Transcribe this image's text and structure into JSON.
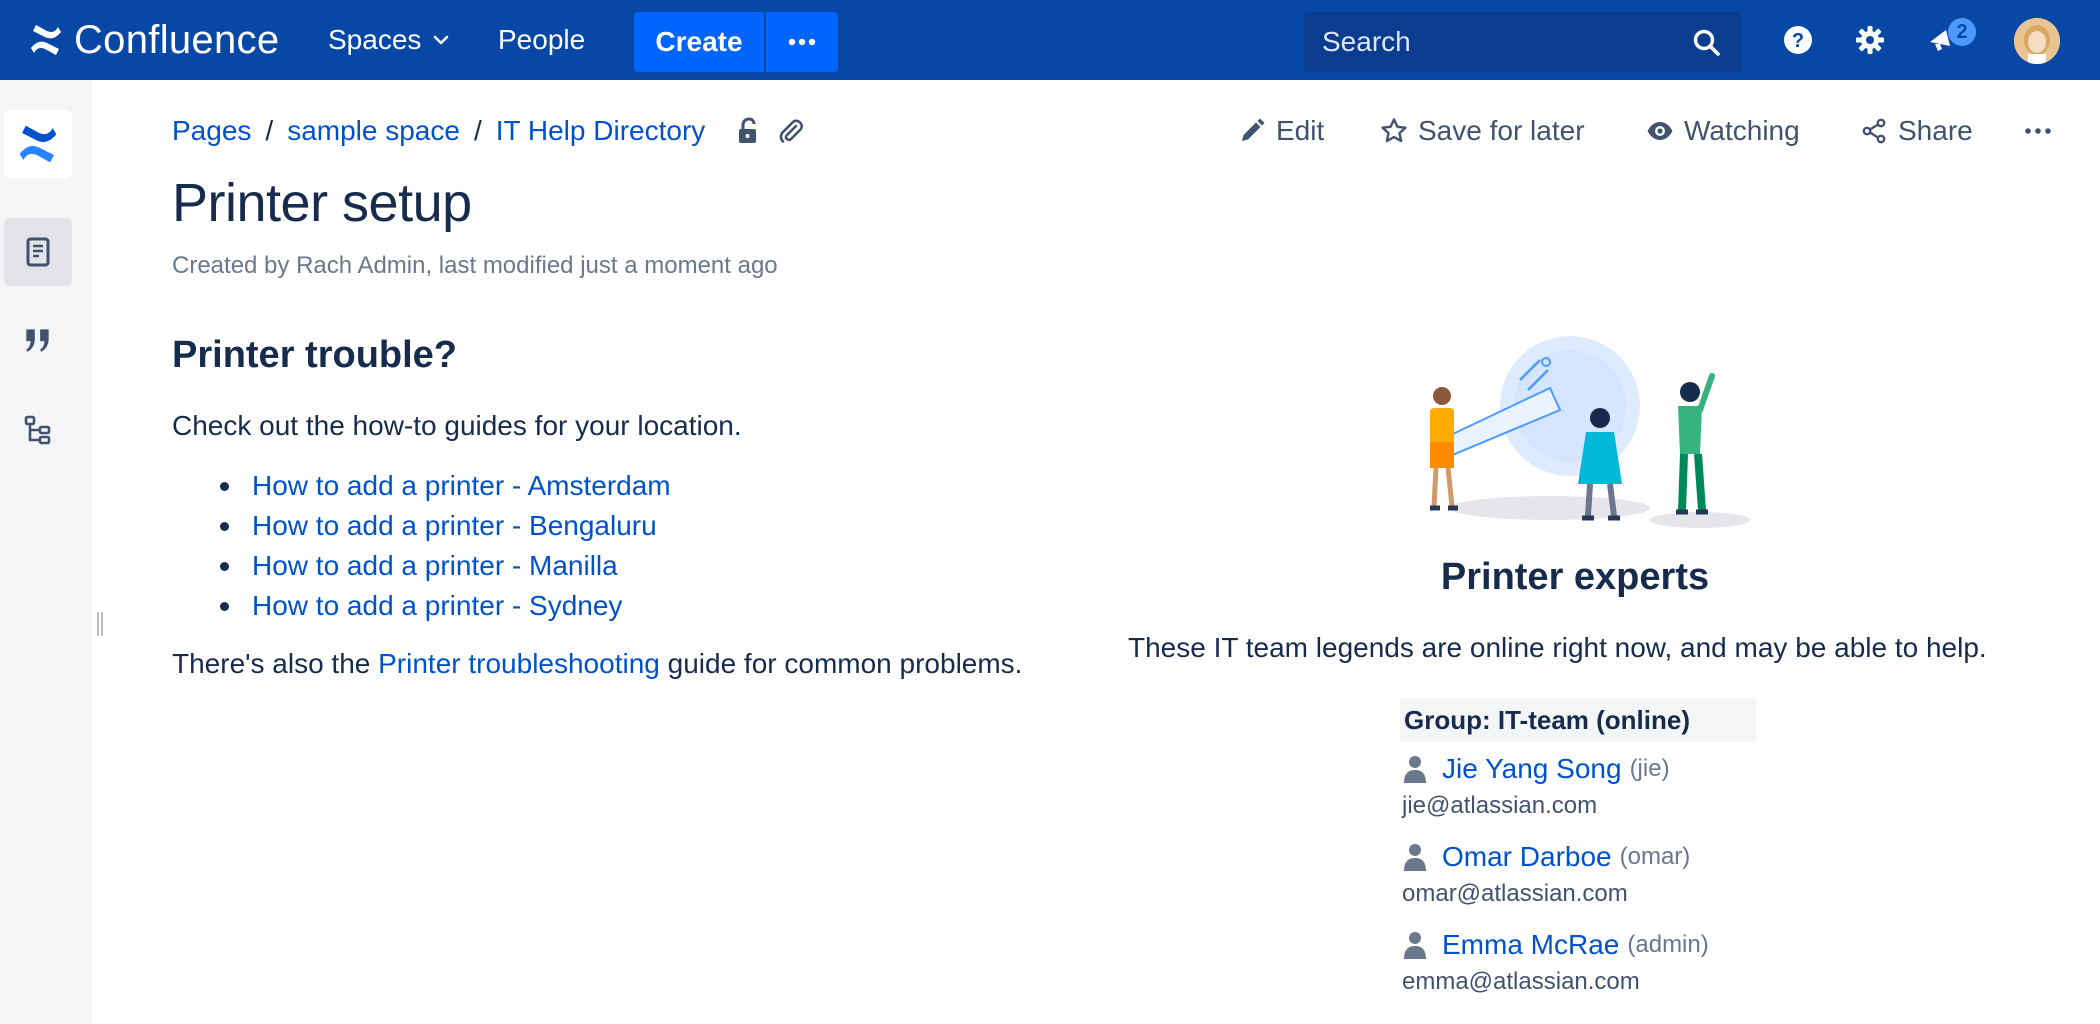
{
  "app": {
    "name": "Confluence"
  },
  "topnav": {
    "spaces_label": "Spaces",
    "people_label": "People",
    "create_label": "Create",
    "search_placeholder": "Search",
    "notification_count": "2"
  },
  "breadcrumb": [
    "Pages",
    "sample space",
    "IT Help Directory"
  ],
  "actions": {
    "edit": "Edit",
    "save_for_later": "Save for later",
    "watching": "Watching",
    "share": "Share"
  },
  "page": {
    "title": "Printer setup",
    "byline": "Created by Rach Admin, last modified just a moment ago"
  },
  "content": {
    "heading": "Printer trouble?",
    "intro": "Check out the how-to guides for your location.",
    "guides": [
      "How to add a printer - Amsterdam",
      "How to add a printer - Bengaluru",
      "How to add a printer - Manilla",
      "How to add a printer - Sydney"
    ],
    "also_prefix": "There's also the ",
    "also_link": "Printer troubleshooting",
    "also_suffix": " guide for common problems."
  },
  "experts": {
    "title": "Printer experts",
    "description": "These IT team legends are online right now, and may be able to help.",
    "group_label": "Group: IT-team (online)",
    "members": [
      {
        "name": "Jie Yang Song",
        "username": "(jie)",
        "email": "jie@atlassian.com"
      },
      {
        "name": "Omar Darboe",
        "username": "(omar)",
        "email": "omar@atlassian.com"
      },
      {
        "name": "Emma McRae",
        "username": "(admin)",
        "email": "emma@atlassian.com"
      }
    ]
  },
  "colors": {
    "nav_bg": "#0747a6",
    "create_bg": "#0065ff",
    "link": "#0052cc",
    "text": "#172b4d",
    "sidebar_bg": "#f4f5f7"
  },
  "icons": [
    "confluence-logo-icon",
    "chevron-down-icon",
    "more-icon",
    "search-icon",
    "help-icon",
    "gear-icon",
    "notification-icon",
    "pages-icon",
    "quotes-icon",
    "tree-icon",
    "unlock-icon",
    "attachment-icon",
    "pencil-icon",
    "star-icon",
    "eye-icon",
    "share-icon",
    "user-icon"
  ]
}
